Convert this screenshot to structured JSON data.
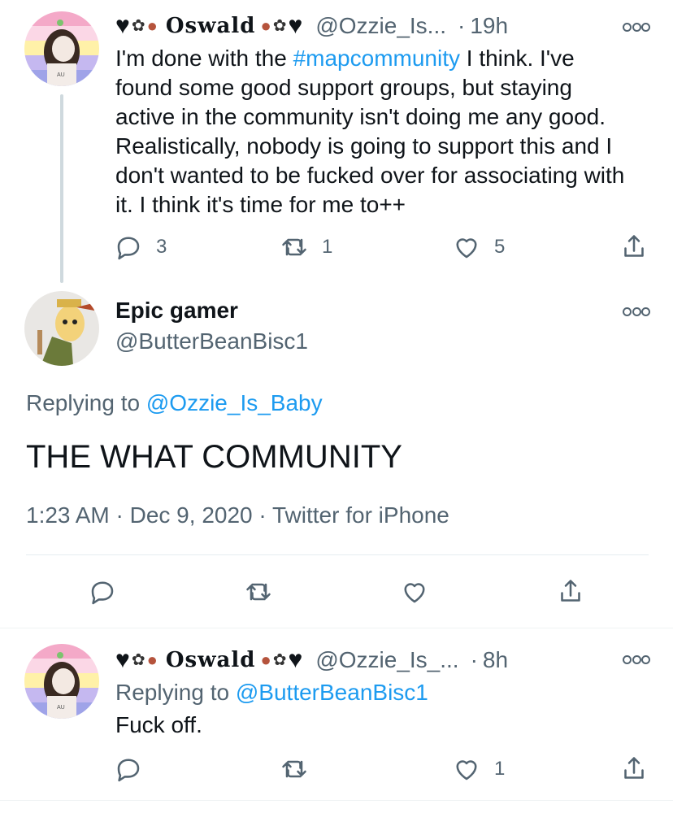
{
  "tweet1": {
    "display_name": "Oswald",
    "handle": "@Ozzie_Is...",
    "time": "19h",
    "text_before": "I'm done with the ",
    "hashtag": "#mapcommunity",
    "text_after": " I think. I've found some good support groups, but staying active in the community isn't doing me any good. Realistically, nobody is going to support this and I don't wanted to be fucked over for associating with it. I think it's time for me to++",
    "replies": "3",
    "retweets": "1",
    "likes": "5"
  },
  "main_tweet": {
    "display_name": "Epic gamer",
    "handle": "@ButterBeanBisc1",
    "replying_prefix": "Replying to ",
    "replying_to": "@Ozzie_Is_Baby",
    "text": "THE WHAT COMMUNITY",
    "meta": "1:23 AM · Dec 9, 2020 · Twitter for iPhone"
  },
  "tweet3": {
    "display_name": "Oswald",
    "handle": "@Ozzie_Is_...",
    "time": "8h",
    "replying_prefix": "Replying to ",
    "replying_to": "@ButterBeanBisc1",
    "text": "Fuck off.",
    "likes": "1"
  },
  "colors": {
    "link": "#1d9bf0",
    "secondary": "#536471",
    "primary_text": "#0f1419"
  },
  "icons": [
    "reply-icon",
    "retweet-icon",
    "like-icon",
    "share-icon",
    "more-icon"
  ]
}
